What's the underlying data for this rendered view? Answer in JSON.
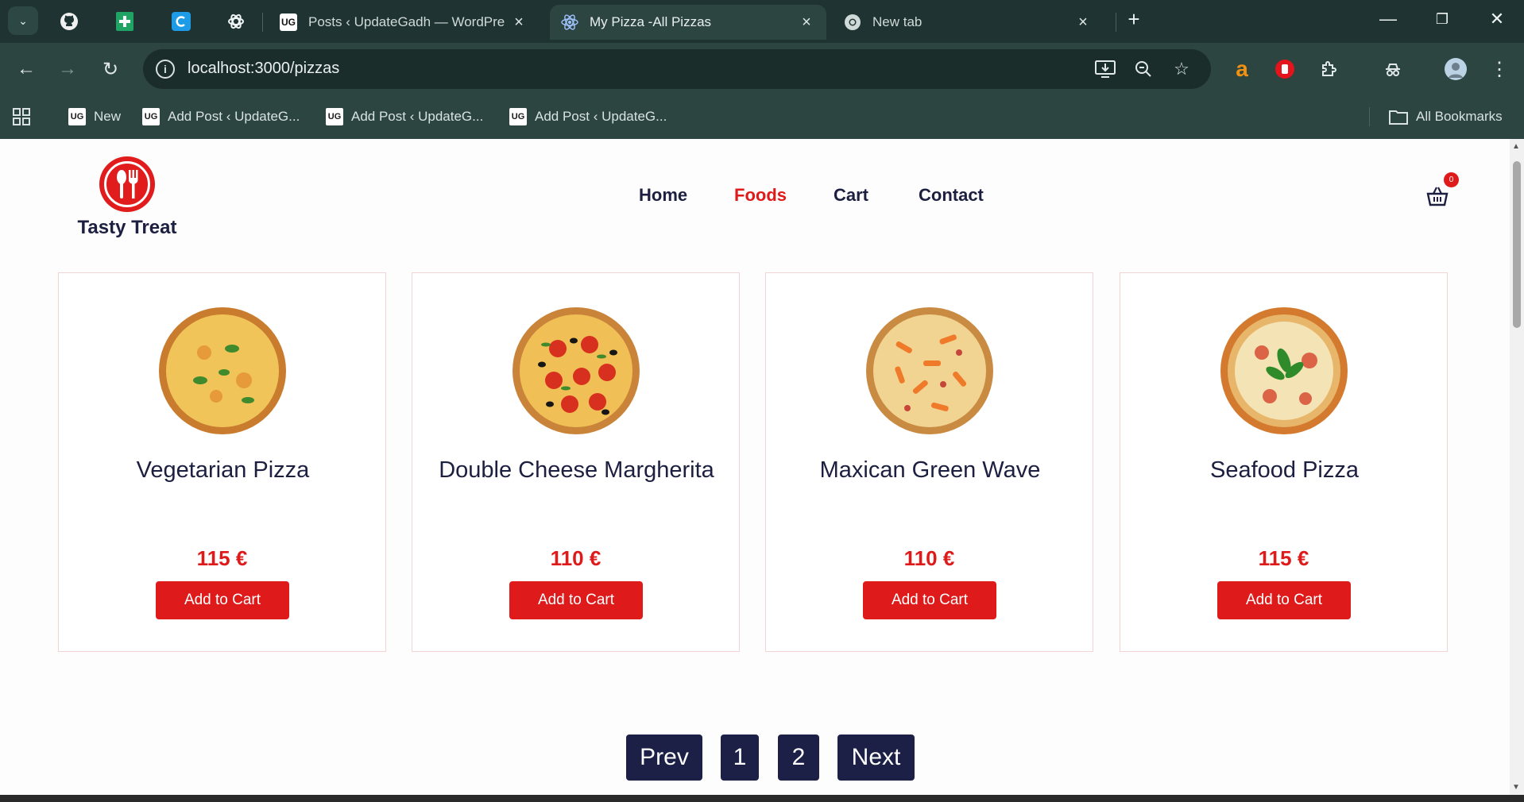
{
  "browser": {
    "tabs": [
      {
        "title": "Posts ‹ UpdateGadh — WordPre",
        "favicon": "ug-icon"
      },
      {
        "title": "My Pizza -All Pizzas",
        "favicon": "react-icon",
        "active": true
      },
      {
        "title": "New tab",
        "favicon": "chrome-icon"
      }
    ],
    "url": "localhost:3000/pizzas",
    "bookmarks": [
      {
        "label": "New"
      },
      {
        "label": "Add Post ‹ UpdateG..."
      },
      {
        "label": "Add Post ‹ UpdateG..."
      },
      {
        "label": "Add Post ‹ UpdateG..."
      }
    ],
    "all_bookmarks": "All Bookmarks",
    "ug_favicon_text": "UG"
  },
  "site": {
    "brand": "Tasty Treat",
    "nav": [
      {
        "label": "Home"
      },
      {
        "label": "Foods",
        "active": true
      },
      {
        "label": "Cart"
      },
      {
        "label": "Contact"
      }
    ],
    "cart_count": "0"
  },
  "products": [
    {
      "name": "Vegetarian Pizza",
      "price": "115 €",
      "button": "Add to Cart"
    },
    {
      "name": "Double Cheese Margherita",
      "price": "110 €",
      "button": "Add to Cart"
    },
    {
      "name": "Maxican Green Wave",
      "price": "110 €",
      "button": "Add to Cart"
    },
    {
      "name": "Seafood Pizza",
      "price": "115 €",
      "button": "Add to Cart"
    }
  ],
  "pagination": {
    "prev": "Prev",
    "pages": [
      "1",
      "2"
    ],
    "next": "Next"
  },
  "colors": {
    "accent": "#df1a1a",
    "dark": "#1c1f46",
    "chrome": "#1f3432"
  }
}
